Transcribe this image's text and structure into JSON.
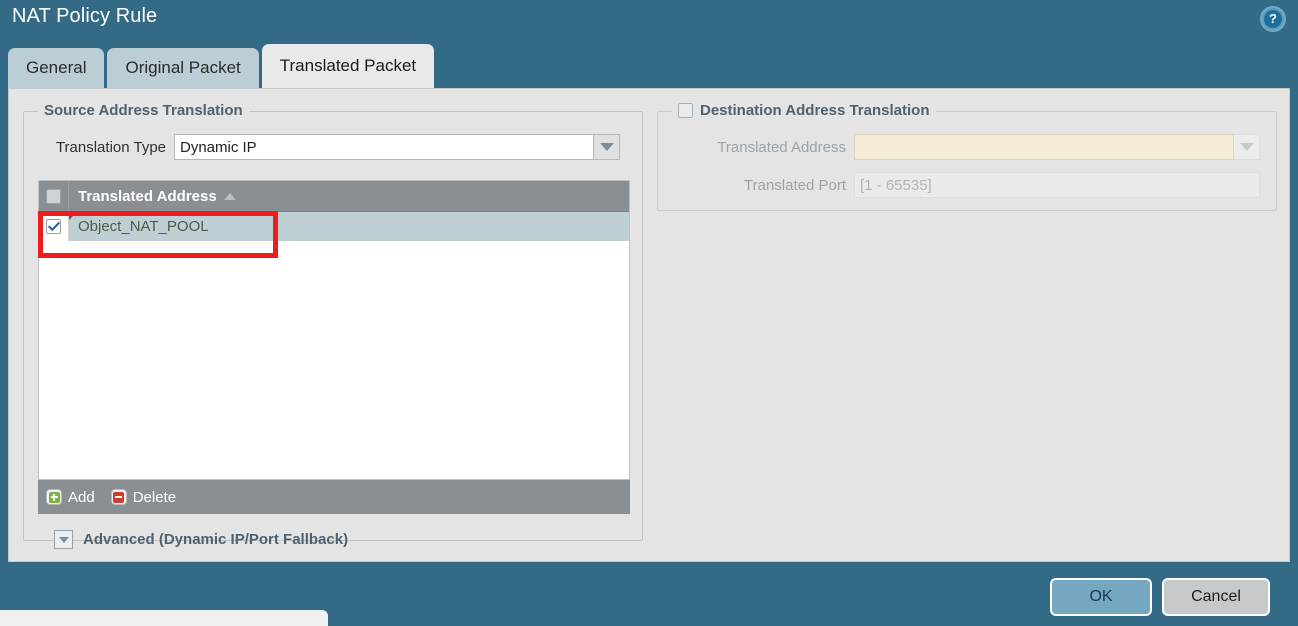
{
  "window": {
    "title": "NAT Policy Rule",
    "help_icon": "help-circle-icon",
    "help_glyph": "?"
  },
  "tabs": [
    {
      "label": "General",
      "active": false
    },
    {
      "label": "Original Packet",
      "active": false
    },
    {
      "label": "Translated Packet",
      "active": true
    }
  ],
  "source_panel": {
    "legend": "Source Address Translation",
    "translation_type": {
      "label": "Translation Type",
      "value": "Dynamic IP"
    },
    "grid": {
      "header_checkbox_checked": false,
      "column": "Translated Address",
      "sort": "ascending",
      "rows": [
        {
          "checked": true,
          "name": "Object_NAT_POOL",
          "selected": true,
          "flagged": true
        }
      ]
    },
    "toolbar": {
      "add_label": "Add",
      "add_icon": "plus-icon",
      "delete_label": "Delete",
      "delete_icon": "minus-icon"
    },
    "advanced": {
      "label": "Advanced (Dynamic IP/Port Fallback)",
      "expanded": false,
      "icon": "chevron-down-icon"
    }
  },
  "destination_panel": {
    "legend": "Destination Address Translation",
    "enabled": false,
    "translated_address": {
      "label": "Translated Address",
      "value": "",
      "placeholder": ""
    },
    "translated_port": {
      "label": "Translated Port",
      "value": "",
      "placeholder": "[1 - 65535]"
    }
  },
  "footer": {
    "ok_label": "OK",
    "cancel_label": "Cancel"
  },
  "colors": {
    "titlebar": "#336b86",
    "tab_active": "#e9e9e9",
    "tab_inactive": "#bbced5",
    "grid_header": "#8a8f94",
    "row_selected": "#bed0d4",
    "required_field": "#f4ecd5",
    "annotation": "#ee1c1c",
    "ok_button": "#74a8c0"
  }
}
